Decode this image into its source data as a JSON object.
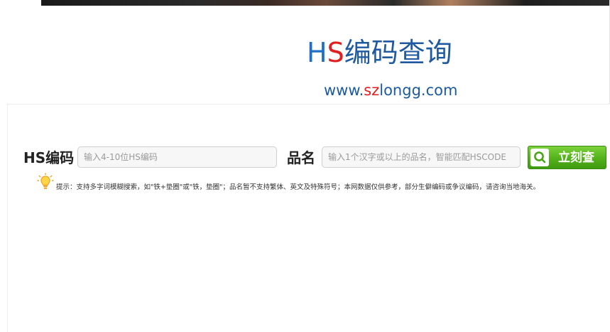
{
  "header": {
    "title_h": "H",
    "title_s": "S",
    "title_rest": "编码查询",
    "url_prefix": "www.",
    "url_highlight": "sz",
    "url_suffix": "longg.com"
  },
  "search": {
    "hs_label": "HS编码",
    "hs_placeholder": "输入4-10位HS编码",
    "name_label": "品名",
    "name_placeholder": "输入1个汉字或以上的品名，智能匹配HSCODE",
    "button_label": "立刻查"
  },
  "tip": {
    "text": "提示：支持多字词模糊搜索，如\"铁+垫圈\"或\"铁，垫圈\"；品名暂不支持繁体、英文及特殊符号；本网数据仅供参考，部分生僻编码或争议编码，请咨询当地海关。"
  },
  "colors": {
    "brand_blue": "#1f5fa8",
    "brand_red": "#e02020",
    "button_green": "#55b41c"
  },
  "icons": {
    "search": "search-icon",
    "tip": "lightbulb-icon"
  }
}
